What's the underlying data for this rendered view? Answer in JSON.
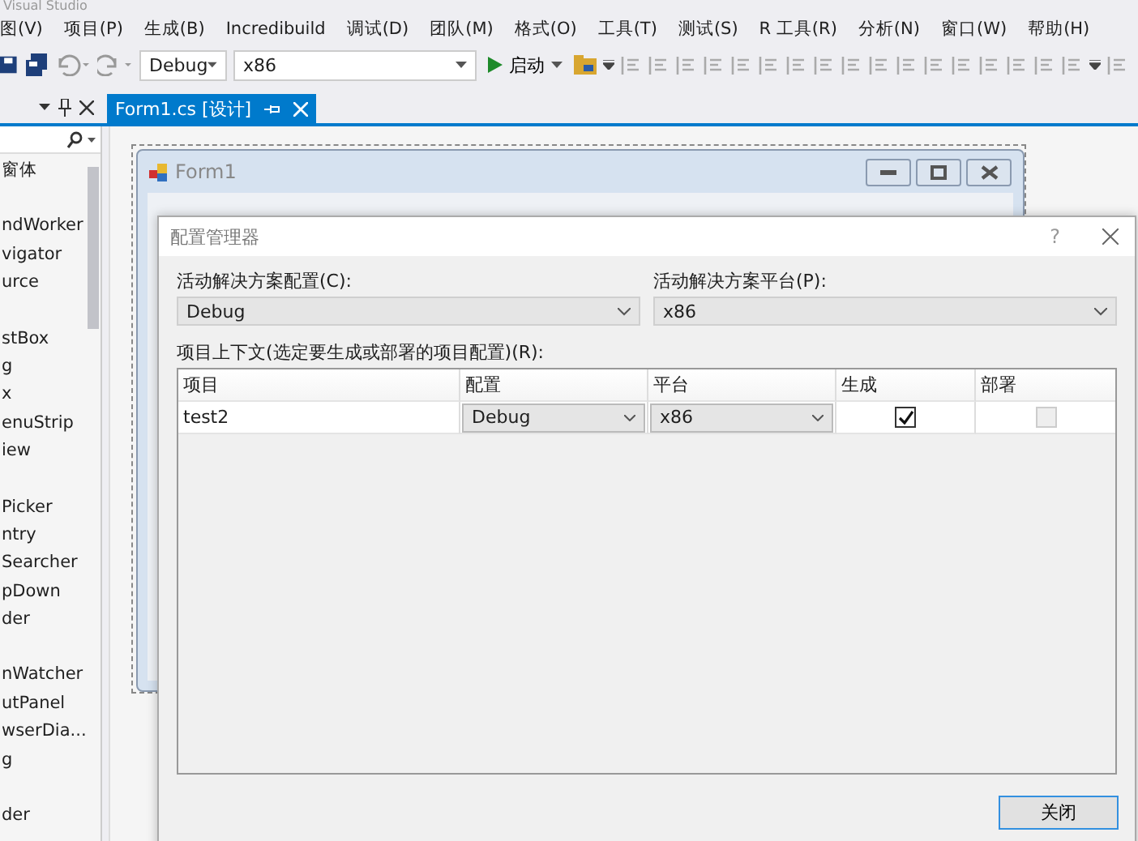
{
  "app_title": "Visual Studio",
  "menu": [
    "图(V)",
    "项目(P)",
    "生成(B)",
    "Incredibuild",
    "调试(D)",
    "团队(M)",
    "格式(O)",
    "工具(T)",
    "测试(S)",
    "R 工具(R)",
    "分析(N)",
    "窗口(W)",
    "帮助(H)"
  ],
  "toolbar": {
    "configuration": "Debug",
    "platform": "x86",
    "start": "启动"
  },
  "toolbox": {
    "groups": [
      [
        "窗体"
      ],
      [
        "ndWorker",
        "vigator",
        "urce"
      ],
      [
        "stBox",
        "g",
        "x",
        "enuStrip",
        "iew"
      ],
      [
        "Picker",
        "ntry",
        "Searcher",
        "pDown",
        "der"
      ],
      [
        "nWatcher",
        "utPanel",
        "wserDia...",
        "g"
      ],
      [
        "der"
      ]
    ]
  },
  "tabs": [
    {
      "label": "Form1.cs [设计]",
      "selected": true
    }
  ],
  "form": {
    "title": "Form1"
  },
  "dialog": {
    "title": "配置管理器",
    "help": "?",
    "config_label": "活动解决方案配置(C):",
    "config_value": "Debug",
    "platform_label": "活动解决方案平台(P):",
    "platform_value": "x86",
    "grid_label": "项目上下文(选定要生成或部署的项目配置)(R):",
    "columns": [
      "项目",
      "配置",
      "平台",
      "生成",
      "部署"
    ],
    "rows": [
      {
        "project": "test2",
        "configuration": "Debug",
        "platform": "x86",
        "build": true,
        "deploy": false,
        "deploy_disabled": true
      }
    ],
    "close": "关闭"
  }
}
